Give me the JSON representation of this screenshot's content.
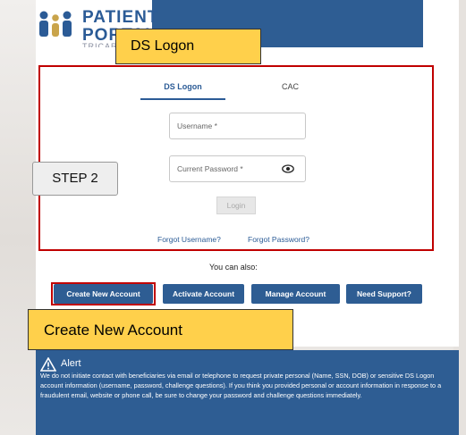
{
  "colors": {
    "header_blue": "#2e5d93",
    "link_blue": "#2b5b96",
    "callout_yellow": "#ffd04b",
    "highlight_red": "#c00000"
  },
  "logo": {
    "text_line1": "PATIENT",
    "text_line2": "PORTAL",
    "subtext": "TRICARE ONLINE"
  },
  "callouts": {
    "ds_logon": "DS Logon",
    "step": "STEP 2",
    "create_account": "Create New Account"
  },
  "tabs": [
    {
      "label": "DS Logon",
      "active": true
    },
    {
      "label": "CAC",
      "active": false
    }
  ],
  "form": {
    "username_placeholder": "Username *",
    "password_placeholder": "Current Password *",
    "password_icon": "eye-icon",
    "login_label": "Login",
    "forgot_username": "Forgot Username?",
    "forgot_password": "Forgot Password?"
  },
  "also_text": "You can also:",
  "actions": [
    "Create New Account",
    "Activate Account",
    "Manage Account",
    "Need Support?"
  ],
  "alert": {
    "icon": "warning-icon",
    "title": "Alert",
    "text": "We do not initiate contact with beneficiaries via email or telephone to request private personal (Name, SSN, DOB) or sensitive DS Logon account information (username, password, challenge questions). If you think you provided personal or account information in response to a fraudulent email, website or phone call, be sure to change your password and challenge questions immediately."
  }
}
